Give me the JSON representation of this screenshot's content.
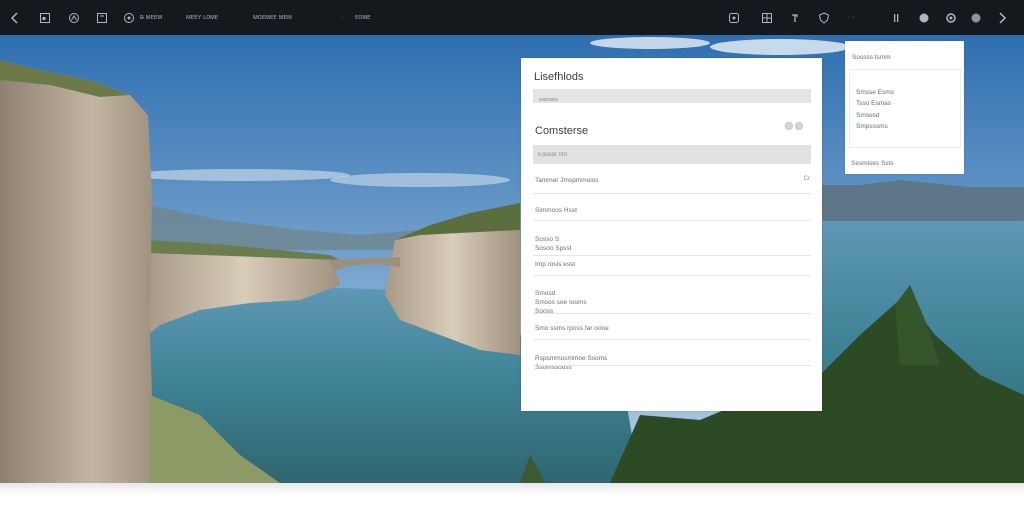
{
  "toolbar": {
    "left_text_1": "ᴃ ᴍᴇᴇᴍ",
    "left_text_2": "ᴍᴇᴇʏ ʟᴏᴍᴇ",
    "left_text_3": "ᴍᴏᴇᴍᴇᴇ ᴍᴇᴍ",
    "left_text_4": "·",
    "left_text_5": "ᴇᴏᴍᴇ",
    "right_text_1": "·  ·"
  },
  "icons": {
    "back": "chevron-left-icon",
    "forward": "chevron-right-icon"
  },
  "panel": {
    "title": "Lisefhlods",
    "bar_text": "ᴇᴍᴇᴇᴍᴇᴇ",
    "section_title": "Comsterse",
    "search_placeholder": "Eoosor nnt",
    "rows": [
      {
        "text": "Tammer Jmspmmoios",
        "value": "Cr"
      },
      {
        "text": "Simmoos Hsst"
      },
      {
        "text": "Sosso S\nSosoo Spsst"
      },
      {
        "text": "Imp rosis esst"
      },
      {
        "text": "Smosd\nSmsos soe Iooms\nSooss"
      },
      {
        "text": "Smo ssms rposs far oooe"
      },
      {
        "text": "Rspsmmusmmoe Ssoms\nSsomssooss"
      }
    ]
  },
  "card": {
    "head": "Sossss tsmm",
    "lines": [
      "Smsse Esms",
      "Tsso Esmas",
      "Smsosd",
      "Smpsssms"
    ],
    "foot": "Sesmises Ssts"
  },
  "colors": {
    "toolbar_bg": "#15181d",
    "sky": "#4a84bf",
    "water": "#3c7f8f"
  }
}
